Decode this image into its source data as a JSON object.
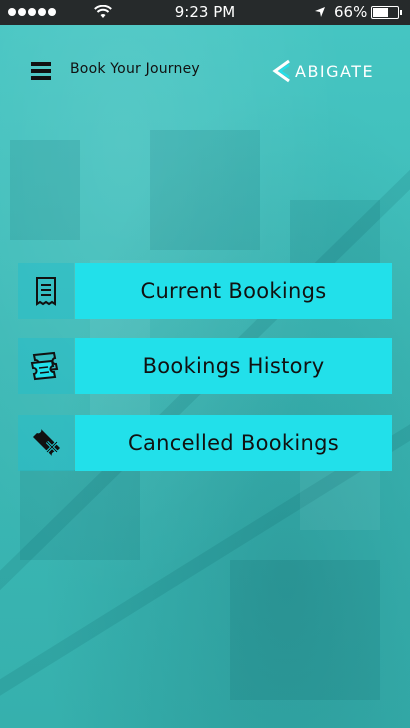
{
  "status_bar": {
    "time": "9:23 PM",
    "battery": "66%",
    "battery_level": 0.66
  },
  "header": {
    "title": "Book Your Journey",
    "logo_text": "ABIGATE",
    "menu_icon": "hamburger-menu-icon"
  },
  "menu": [
    {
      "label": "Current Bookings",
      "icon": "receipt-icon"
    },
    {
      "label": "Bookings History",
      "icon": "tickets-icon"
    },
    {
      "label": "Cancelled Bookings",
      "icon": "cancelled-ticket-icon"
    }
  ],
  "colors": {
    "background": "#3bbbb8",
    "button": "#22e0ea",
    "icon_box": "#2fbcc8",
    "status_bar": "#262a2b"
  }
}
